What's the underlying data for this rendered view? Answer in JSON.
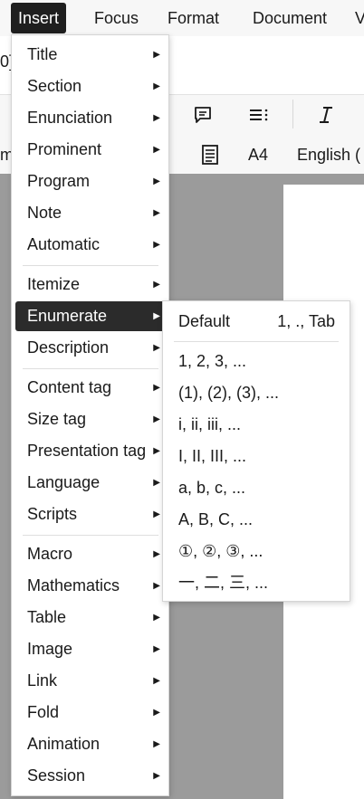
{
  "menubar": {
    "items": [
      "Insert",
      "Focus",
      "Format",
      "Document",
      "V"
    ]
  },
  "background": {
    "tab_fragment": "0]",
    "toolbar_left_fragment": "m",
    "paper_size": "A4",
    "language": "English ("
  },
  "icons": [
    "comment-icon",
    "list-icon",
    "italic-icon",
    "document-icon"
  ],
  "insert_menu": {
    "groups": [
      [
        "Title",
        "Section",
        "Enunciation",
        "Prominent",
        "Program",
        "Note",
        "Automatic"
      ],
      [
        "Itemize",
        "Enumerate",
        "Description"
      ],
      [
        "Content tag",
        "Size tag",
        "Presentation tag",
        "Language",
        "Scripts"
      ],
      [
        "Macro",
        "Mathematics",
        "Table",
        "Image",
        "Link",
        "Fold",
        "Animation",
        "Session"
      ]
    ],
    "active": "Enumerate"
  },
  "enumerate_submenu": {
    "default_label": "Default",
    "default_shortcut": "1, ., Tab",
    "items": [
      "1, 2, 3, ...",
      "(1), (2), (3), ...",
      "i, ii, iii, ...",
      "I, II, III, ...",
      "a, b, c, ...",
      "A, B, C, ...",
      "①, ②, ③, ...",
      "一, 二, 三, ..."
    ]
  },
  "colors": {
    "menubar_bg": "#f7f7f7",
    "active_bg": "#2b2b2b",
    "canvas_bg": "#9b9b9b"
  }
}
